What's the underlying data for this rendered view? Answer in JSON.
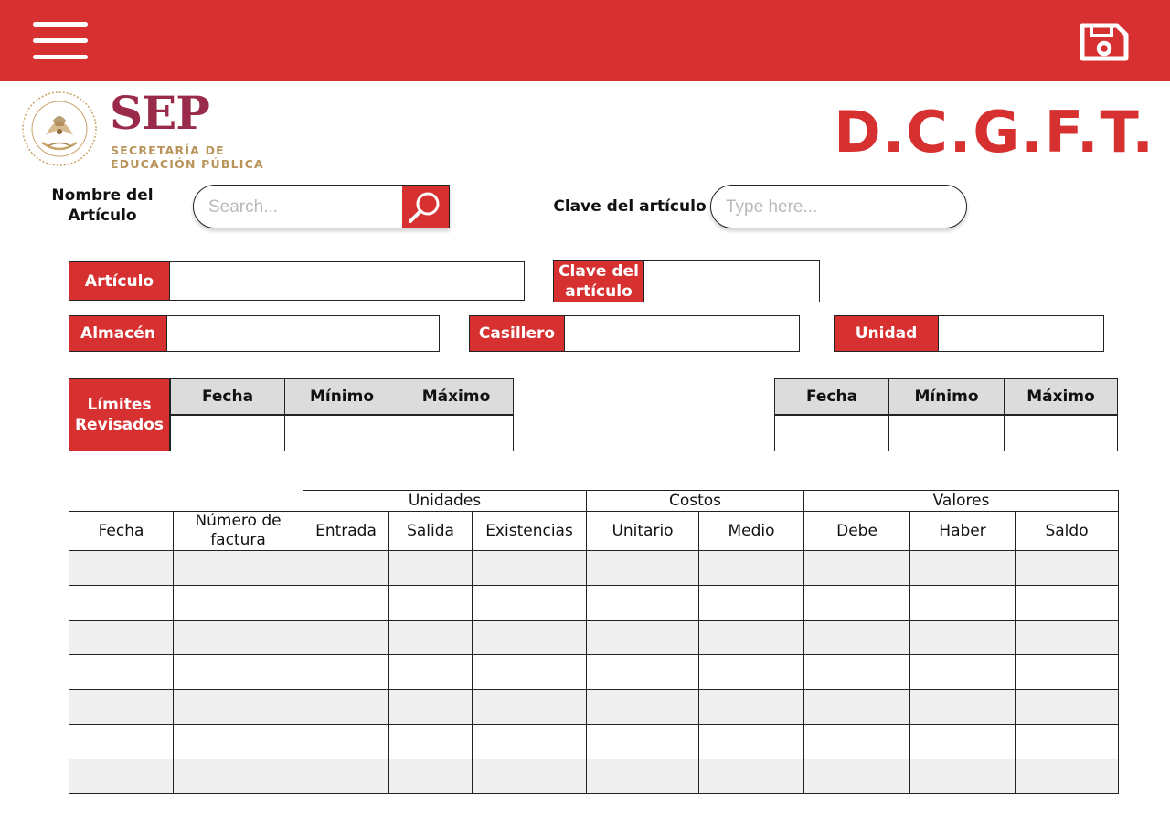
{
  "header": {
    "menu_icon": "hamburger-menu-icon",
    "save_icon": "save-disk-icon",
    "bar_color": "#d63031"
  },
  "logo": {
    "acronym": "SEP",
    "line1": "SECRETARÍA DE",
    "line2": "EDUCACIÓN PÚBLICA",
    "seal_icon": "mexico-coat-of-arms-seal",
    "acronym_color": "#9a2a4a",
    "subtitle_color": "#b8945a"
  },
  "page_title": "D.C.G.F.T.",
  "search": {
    "name_label": "Nombre del Artículo",
    "name_placeholder": "Search...",
    "search_icon": "search-icon",
    "clave_label": "Clave del artículo",
    "clave_placeholder": "Type here..."
  },
  "fields": {
    "articulo": "Artículo",
    "clave": "Clave del artículo",
    "almacen": "Almacén",
    "casillero": "Casillero",
    "unidad": "Unidad"
  },
  "limits": {
    "label": "Límites Revisados",
    "headers": [
      "Fecha",
      "Mínimo",
      "Máximo"
    ],
    "headers_right": [
      "Fecha",
      "Mínimo",
      "Máximo"
    ]
  },
  "ledger": {
    "groups": {
      "unidades": "Unidades",
      "costos": "Costos",
      "valores": "Valores"
    },
    "columns": [
      "Fecha",
      "Número de factura",
      "Entrada",
      "Salida",
      "Existencias",
      "Unitario",
      "Medio",
      "Debe",
      "Haber",
      "Saldo"
    ],
    "row_count": 7
  },
  "accent_color": "#d63031"
}
